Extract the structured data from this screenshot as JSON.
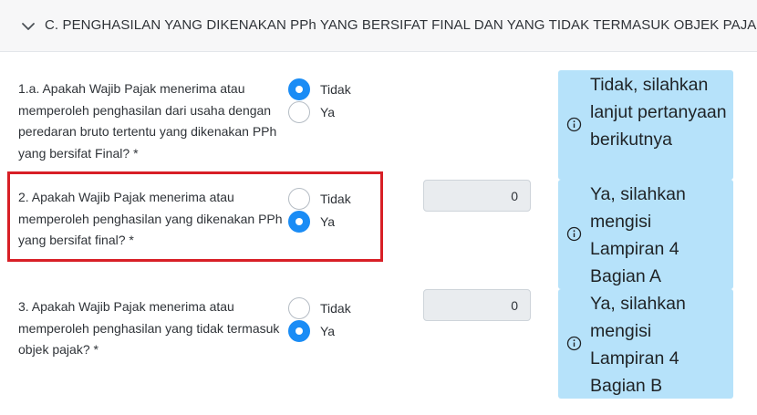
{
  "section": {
    "title": "C. PENGHASILAN YANG DIKENAKAN PPh YANG BERSIFAT FINAL DAN YANG TIDAK TERMASUK OBJEK PAJAK"
  },
  "questions": [
    {
      "text": "1.a. Apakah Wajib Pajak menerima atau memperoleh penghasilan dari usaha dengan peredaran bruto tertentu yang dikenakan PPh yang bersifat Final? *",
      "options": [
        {
          "label": "Tidak",
          "checked": true
        },
        {
          "label": "Ya",
          "checked": false
        }
      ],
      "info": "Tidak, silahkan lanjut pertanyaan berikutnya"
    },
    {
      "text": "2. Apakah Wajib Pajak menerima atau memperoleh penghasilan yang dikenakan PPh yang bersifat final? *",
      "options": [
        {
          "label": "Tidak",
          "checked": false
        },
        {
          "label": "Ya",
          "checked": true
        }
      ],
      "amount": "0",
      "info": "Ya, silahkan mengisi Lampiran 4 Bagian A"
    },
    {
      "text": "3. Apakah Wajib Pajak menerima atau memperoleh penghasilan yang tidak termasuk objek pajak? *",
      "options": [
        {
          "label": "Tidak",
          "checked": false
        },
        {
          "label": "Ya",
          "checked": true
        }
      ],
      "amount": "0",
      "info": "Ya, silahkan mengisi Lampiran 4 Bagian B"
    }
  ],
  "colors": {
    "accent": "#1a8cf5",
    "info_bg": "#b6e2fa",
    "highlight": "#d81f26"
  }
}
